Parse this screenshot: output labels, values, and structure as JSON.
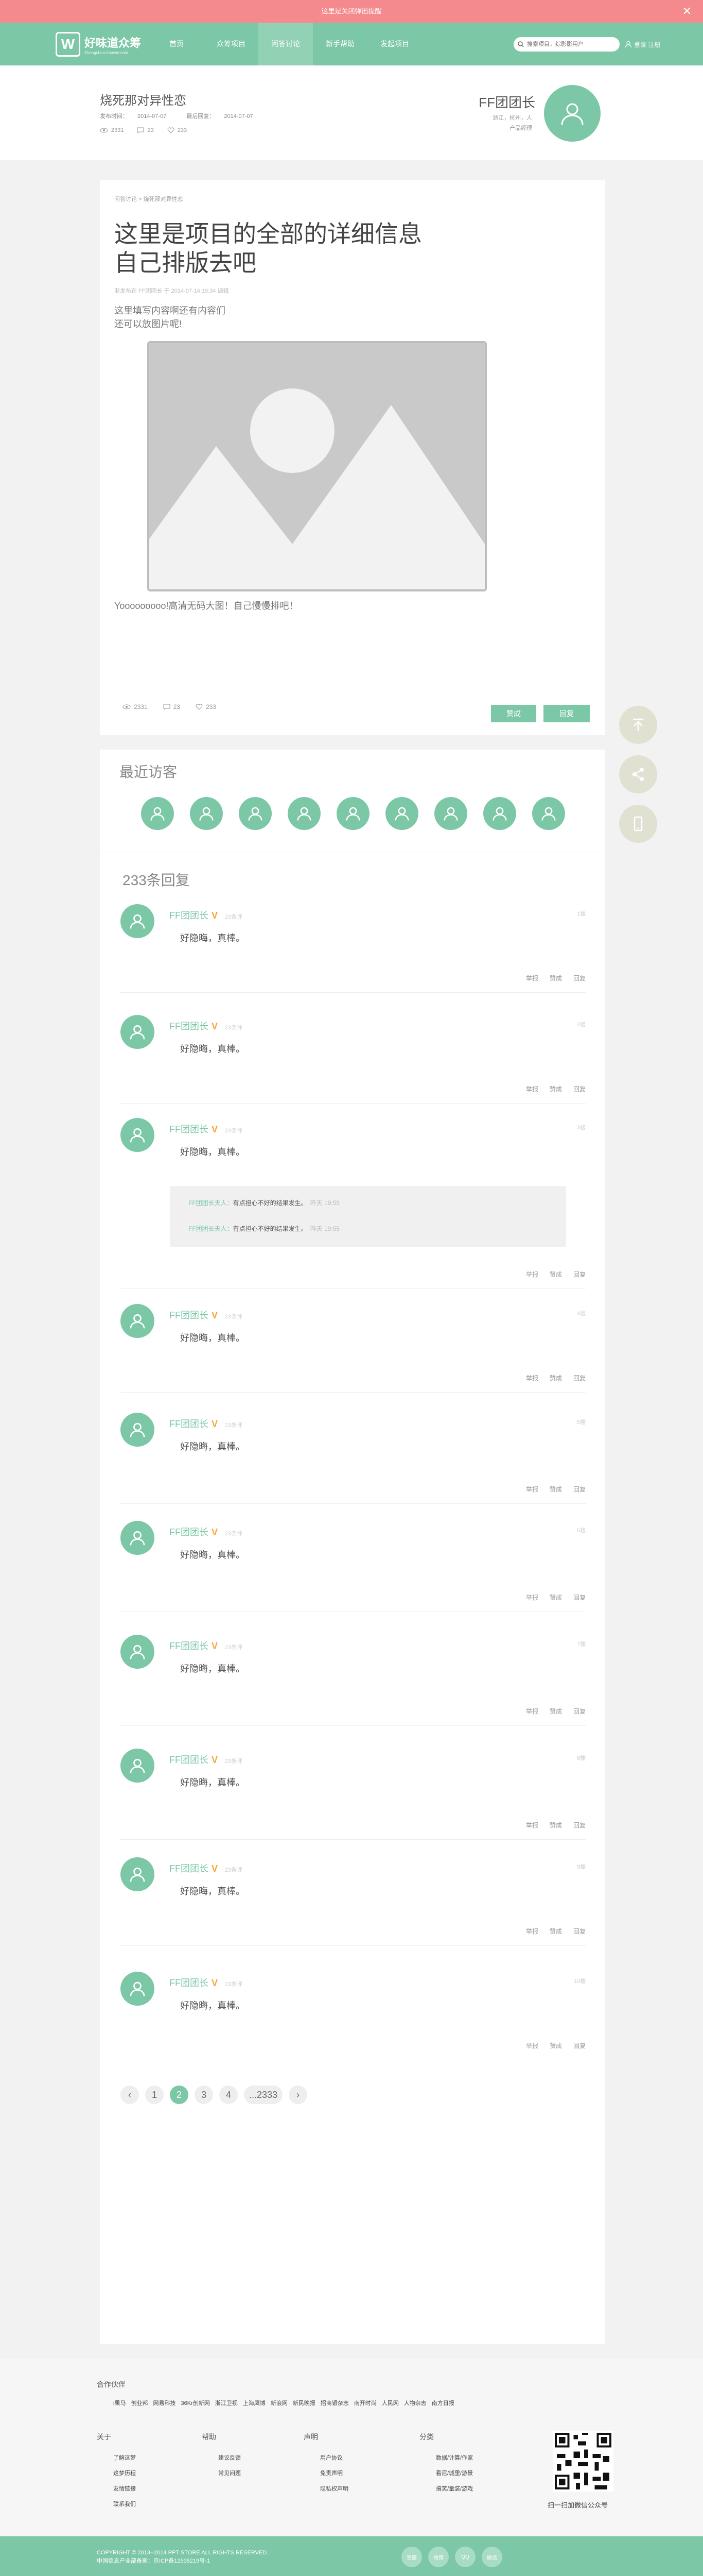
{
  "announcement": {
    "text": "这里是关闭弹出提醒",
    "close_glyph": "✕"
  },
  "nav": {
    "logo_mark": "W",
    "logo_title": "好味道众筹",
    "logo_sub": "Zhongchou.haowei.com",
    "items": [
      "首页",
      "众筹项目",
      "问答讨论",
      "新手帮助",
      "发起项目"
    ],
    "active_index": 2,
    "search_placeholder": "搜索项目，综影影用户",
    "login_label": "登录 注册"
  },
  "project": {
    "title": "烧死那对异性恋",
    "start_label": "发布时间：",
    "start_date": "2014-07-07",
    "update_label": "最后回复：",
    "update_date": "2014-07-07",
    "views": "2331",
    "comments": "23",
    "likes": "233"
  },
  "owner": {
    "name": "FF团团长",
    "desc_line1": "浙江，杭州，人",
    "desc_line2": "产品经理"
  },
  "article": {
    "breadcrumb": "问答讨论 > 烧死那对异性恋",
    "title_line1": "这里是项目的全部的详细信息",
    "title_line2": "自己排版去吧",
    "meta": "浙发布在 FF团团长 于 2014-07-14 19:34 编辑",
    "text_line1": "这里填写内容啊还有内容们",
    "text_line2": "还可以放图片呢!",
    "footer_text": "Yooooooooo!高清无码大图！自己慢慢排吧！",
    "views": "2331",
    "comments": "23",
    "likes": "233",
    "btn_like": "赞成",
    "btn_reply": "回复"
  },
  "visitors": {
    "title": "最近访客",
    "count": 9
  },
  "replies": {
    "title": "233条回复",
    "items": [
      {
        "name": "FF团团长",
        "time": "23条评",
        "text": "好隐晦，真棒。",
        "num": "1楼"
      },
      {
        "name": "FF团团长",
        "time": "23条评",
        "text": "好隐晦，真棒。",
        "num": "2楼"
      },
      {
        "name": "FF团团长",
        "time": "23条评",
        "text": "好隐晦，真棒。",
        "num": "3楼"
      },
      {
        "name": "FF团团长",
        "time": "23条评",
        "text": "好隐晦，真棒。",
        "num": "4楼"
      },
      {
        "name": "FF团团长",
        "time": "23条评",
        "text": "好隐晦，真棒。",
        "num": "5楼"
      },
      {
        "name": "FF团团长",
        "time": "23条评",
        "text": "好隐晦，真棒。",
        "num": "6楼"
      },
      {
        "name": "FF团团长",
        "time": "23条评",
        "text": "好隐晦，真棒。",
        "num": "7楼"
      },
      {
        "name": "FF团团长",
        "time": "23条评",
        "text": "好隐晦，真棒。",
        "num": "8楼"
      },
      {
        "name": "FF团团长",
        "time": "23条评",
        "text": "好隐晦，真棒。",
        "num": "9楼"
      },
      {
        "name": "FF团团长",
        "time": "23条评",
        "text": "好隐晦，真棒。",
        "num": "10楼"
      }
    ],
    "action_report": "举报",
    "action_like": "赞成",
    "action_reply": "回复",
    "sub": [
      {
        "name": "FF团团长夫人：",
        "text": "有点担心不好的结果发生。",
        "time": "昨天 19:55"
      },
      {
        "name": "FF团团长夫人：",
        "text": "有点担心不好的结果发生。",
        "time": "昨天 19:55"
      }
    ]
  },
  "pager": {
    "prev": "‹",
    "pages": [
      "1",
      "2",
      "3",
      "4",
      "...2333"
    ],
    "active_index": 1,
    "next": "›"
  },
  "footer": {
    "partners_title": "合作伙伴",
    "partners": [
      "i果马",
      "创业邦",
      "网易科技",
      "36Kr创新网",
      "浙江卫视",
      "上海鹰博",
      "新浪网",
      "新民晚报",
      "招商银杂志",
      "南开时尚",
      "人民网",
      "人物杂志",
      "南方日报"
    ],
    "columns": [
      {
        "title": "关于",
        "links": [
          "了解这梦",
          "这梦历程",
          "友情链接",
          "联系我们"
        ]
      },
      {
        "title": "帮助",
        "links": [
          "建议反馈",
          "常见问题"
        ]
      },
      {
        "title": "声明",
        "links": [
          "用户协议",
          "免责声明",
          "隐私权声明"
        ]
      },
      {
        "title": "分类",
        "links": [
          "数据/计算/作家",
          "看尼/城里/游景",
          "搞笑/量装/游戏"
        ]
      }
    ],
    "qr_label": "扫一扫加微信公众号",
    "copyright_line1": "COPYRIGHT © 2013--2014 PPT STORE ALL RIGHTS RESERVED.",
    "copyright_line2": "中国信息产业部备案：京ICP备12535219号-1",
    "social": [
      "豆瓣",
      "微博",
      "QQ",
      "微信"
    ]
  },
  "colors": {
    "accent": "#7cc7a6",
    "announce": "#f48a8e",
    "float": "#e1e1d2"
  }
}
